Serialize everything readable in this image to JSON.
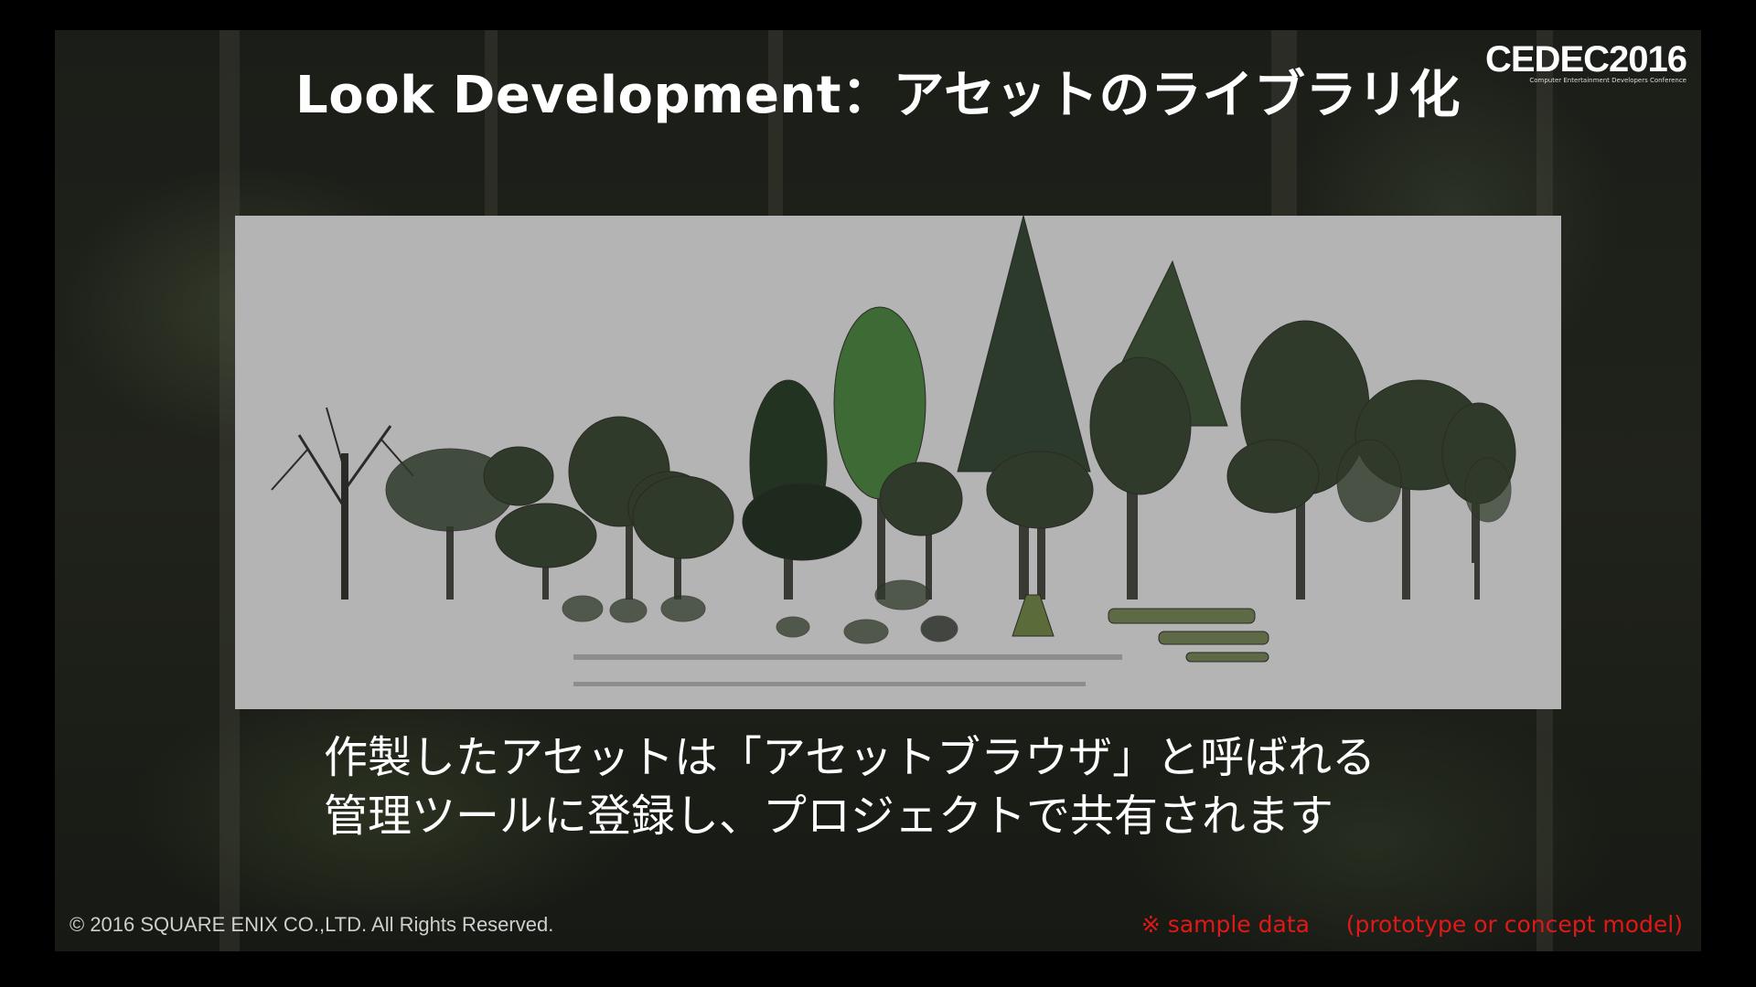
{
  "slide": {
    "title": "Look Development：アセットのライブラリ化",
    "logo": {
      "main": "CEDEC2016",
      "sub": "Computer Entertainment Developers Conference"
    },
    "body_lines": [
      "作製したアセットは「アセットブラウザ」と呼ばれる",
      "管理ツールに登録し、プロジェクトで共有されます"
    ],
    "copyright": "© 2016 SQUARE ENIX CO.,LTD. All Rights Reserved.",
    "note": {
      "mark": "※",
      "text": "sample data",
      "paren": "(prototype or concept model)"
    },
    "colors": {
      "panel_bg": "#b3b4b3",
      "note": "#e01818",
      "foliage": "#2f3a2a"
    }
  }
}
